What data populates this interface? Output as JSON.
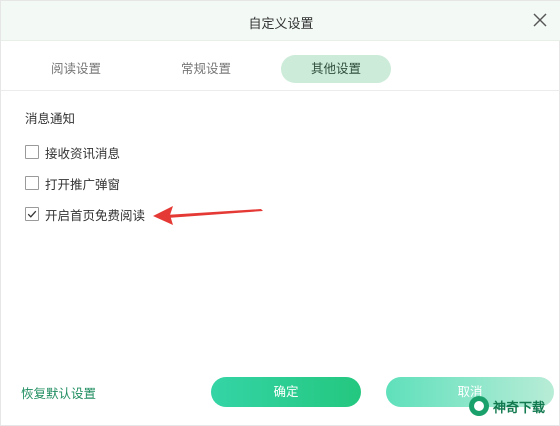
{
  "window": {
    "title": "自定义设置"
  },
  "tabs": [
    {
      "label": "阅读设置",
      "active": false
    },
    {
      "label": "常规设置",
      "active": false
    },
    {
      "label": "其他设置",
      "active": true
    }
  ],
  "section": {
    "title": "消息通知"
  },
  "options": [
    {
      "label": "接收资讯消息",
      "checked": false
    },
    {
      "label": "打开推广弹窗",
      "checked": false
    },
    {
      "label": "开启首页免费阅读",
      "checked": true
    }
  ],
  "footer": {
    "restore_label": "恢复默认设置",
    "ok_label": "确定",
    "cancel_label": "取消"
  },
  "watermark": {
    "text": "神奇下载"
  },
  "colors": {
    "accent": "#24c77f",
    "active_tab": "#cdebd9",
    "arrow": "#e53935",
    "link": "#1f8d5f"
  },
  "icons": {
    "close": "close-icon",
    "check": "check-icon",
    "arrow": "annotation-arrow"
  }
}
